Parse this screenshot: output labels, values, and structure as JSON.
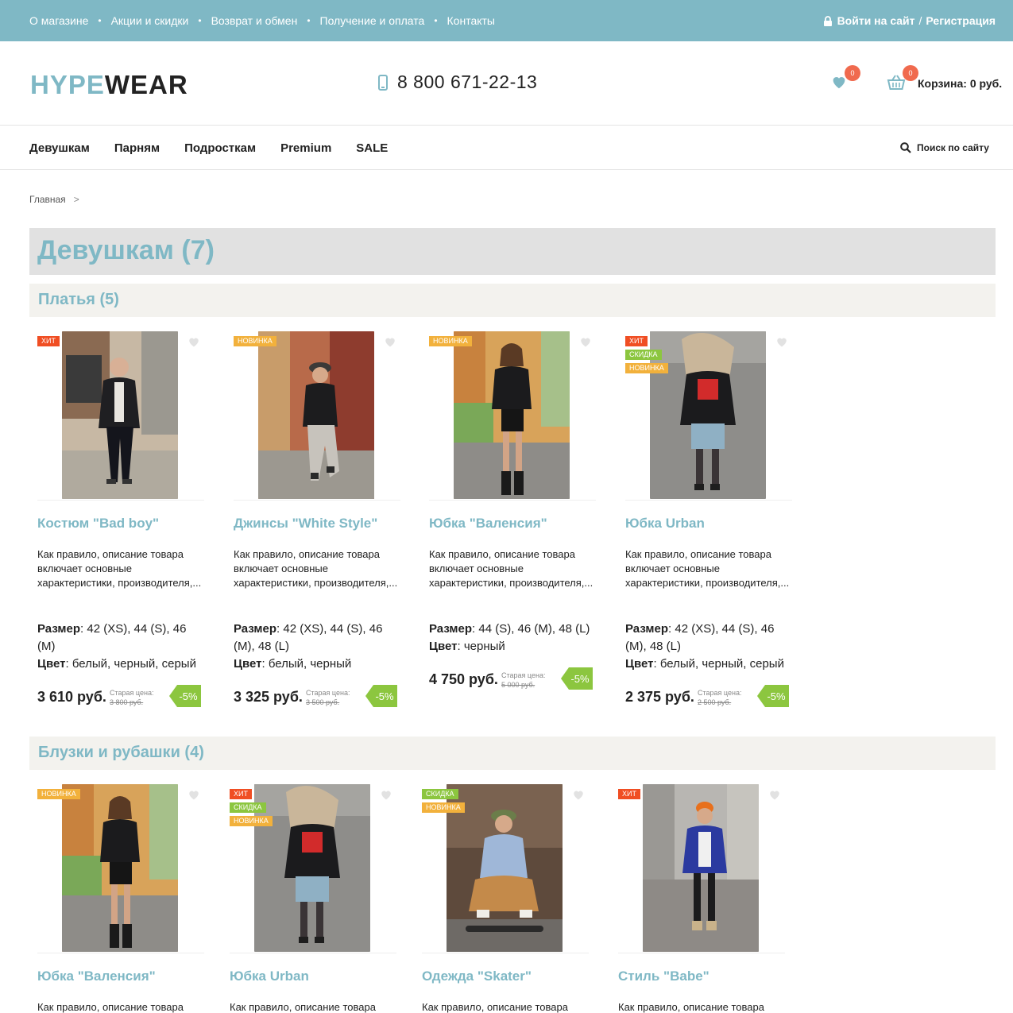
{
  "topbar": {
    "links": [
      "О магазине",
      "Акции и скидки",
      "Возврат и обмен",
      "Получение и оплата",
      "Контакты"
    ],
    "login": "Войти на сайт",
    "separator": "/",
    "register": "Регистрация",
    "color": "#7fb8c5"
  },
  "header": {
    "logo_part1": "HYPE",
    "logo_part2": "WEAR",
    "phone": "8 800 671-22-13",
    "favorites_count": "0",
    "cart_count": "0",
    "cart_label": "Корзина: 0 руб."
  },
  "nav": {
    "items": [
      "Девушкам",
      "Парням",
      "Подросткам",
      "Premium",
      "SALE"
    ],
    "search_label": "Поиск по сайту"
  },
  "breadcrumb": {
    "home": "Главная",
    "chevron": ">"
  },
  "page_title": "Девушкам (7)",
  "sections": [
    {
      "title": "Платья (5)",
      "products": [
        {
          "name": "Костюм \"Bad boy\"",
          "tags": [
            "ХИТ"
          ],
          "desc": "Как правило, описание товара включает основные характеристики, производителя,...",
          "size_label": "Размер",
          "size": ": 42 (XS), 44 (S), 46 (M)",
          "color_label": "Цвет",
          "color": ": белый, черный, серый",
          "price": "3 610 руб.",
          "old_label": "Старая цена:",
          "old_price": "3 800 руб.",
          "discount": "-5%"
        },
        {
          "name": "Джинсы \"White Style\"",
          "tags": [
            "НОВИНКА"
          ],
          "desc": "Как правило, описание товара включает основные характеристики, производителя,...",
          "size_label": "Размер",
          "size": ": 42 (XS), 44 (S), 46 (M), 48 (L)",
          "color_label": "Цвет",
          "color": ": белый, черный",
          "price": "3 325 руб.",
          "old_label": "Старая цена:",
          "old_price": "3 500 руб.",
          "discount": "-5%"
        },
        {
          "name": "Юбка \"Валенсия\"",
          "tags": [
            "НОВИНКА"
          ],
          "desc": "Как правило, описание товара включает основные характеристики, производителя,...",
          "size_label": "Размер",
          "size": ": 44 (S), 46 (M), 48 (L)",
          "color_label": "Цвет",
          "color": ": черный",
          "price": "4 750 руб.",
          "old_label": "Старая цена:",
          "old_price": "5 000 руб.",
          "discount": "-5%"
        },
        {
          "name": "Юбка Urban",
          "tags": [
            "ХИТ",
            "СКИДКА",
            "НОВИНКА"
          ],
          "desc": "Как правило, описание товара включает основные характеристики, производителя,...",
          "size_label": "Размер",
          "size": ": 42 (XS), 44 (S), 46 (M), 48 (L)",
          "color_label": "Цвет",
          "color": ": белый, черный, серый",
          "price": "2 375 руб.",
          "old_label": "Старая цена:",
          "old_price": "2 500 руб.",
          "discount": "-5%"
        }
      ]
    },
    {
      "title": "Блузки и рубашки (4)",
      "products": [
        {
          "name": "Юбка \"Валенсия\"",
          "tags": [
            "НОВИНКА"
          ],
          "desc": "Как правило, описание товара"
        },
        {
          "name": "Юбка Urban",
          "tags": [
            "ХИТ",
            "СКИДКА",
            "НОВИНКА"
          ],
          "desc": "Как правило, описание товара"
        },
        {
          "name": "Одежда \"Skater\"",
          "tags": [
            "СКИДКА",
            "НОВИНКА"
          ],
          "desc": "Как правило, описание товара"
        },
        {
          "name": "Стиль \"Babe\"",
          "tags": [
            "ХИТ"
          ],
          "desc": "Как правило, описание товара"
        }
      ]
    }
  ]
}
